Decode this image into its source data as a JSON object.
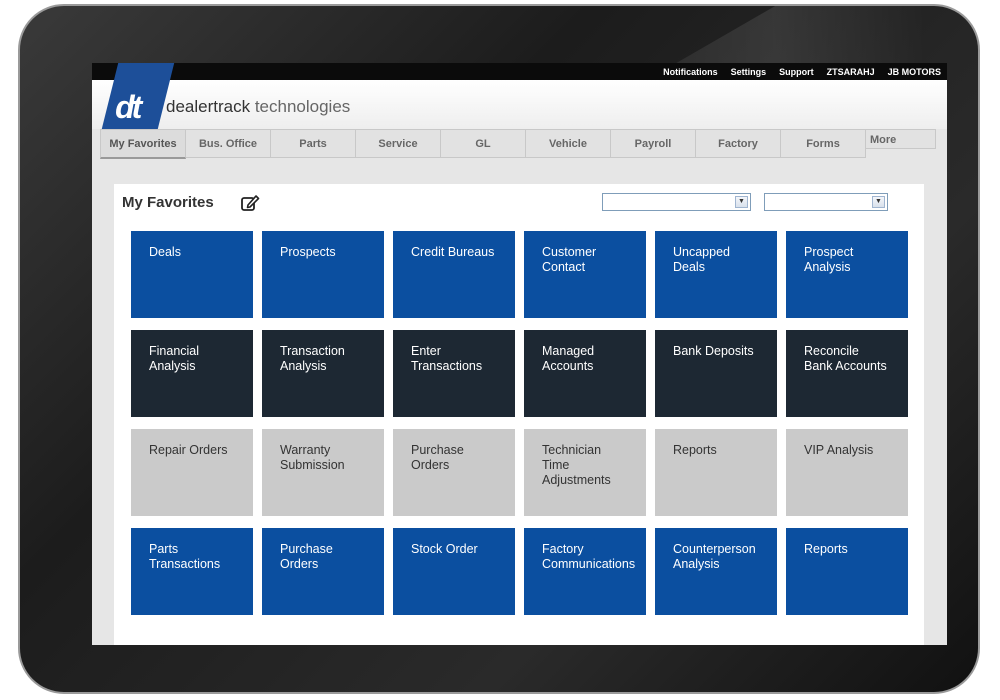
{
  "topbar": {
    "links": [
      "Notifications",
      "Settings",
      "Support",
      "ZTSARAHJ",
      "JB MOTORS"
    ]
  },
  "brand": {
    "mark": "dt",
    "name_bold": "dealertrack",
    "name_light": " technologies"
  },
  "tabs": [
    "My Favorites",
    "Bus. Office",
    "Parts",
    "Service",
    "GL",
    "Vehicle",
    "Payroll",
    "Factory",
    "Forms",
    "More"
  ],
  "favorites": {
    "title": "My Favorites",
    "select1_value": "",
    "select2_value": ""
  },
  "tiles": [
    {
      "label": "Deals",
      "style": "blue"
    },
    {
      "label": "Prospects",
      "style": "blue"
    },
    {
      "label": "Credit Bureaus",
      "style": "blue"
    },
    {
      "label": "Customer Contact",
      "style": "blue"
    },
    {
      "label": "Uncapped Deals",
      "style": "blue"
    },
    {
      "label": "Prospect Analysis",
      "style": "blue"
    },
    {
      "label": "Financial Analysis",
      "style": "dark"
    },
    {
      "label": "Transaction Analysis",
      "style": "dark"
    },
    {
      "label": "Enter Transactions",
      "style": "dark"
    },
    {
      "label": "Managed Accounts",
      "style": "dark"
    },
    {
      "label": "Bank Deposits",
      "style": "dark"
    },
    {
      "label": "Reconcile Bank Accounts",
      "style": "dark"
    },
    {
      "label": "Repair Orders",
      "style": "gray"
    },
    {
      "label": "Warranty Submission",
      "style": "gray"
    },
    {
      "label": "Purchase Orders",
      "style": "gray"
    },
    {
      "label": "Technician Time Adjustments",
      "style": "gray"
    },
    {
      "label": "Reports",
      "style": "gray"
    },
    {
      "label": "VIP Analysis",
      "style": "gray"
    },
    {
      "label": "Parts Transactions",
      "style": "blue"
    },
    {
      "label": "Purchase Orders",
      "style": "blue"
    },
    {
      "label": "Stock Order",
      "style": "blue"
    },
    {
      "label": "Factory Communications",
      "style": "blue"
    },
    {
      "label": "Counterperson Analysis",
      "style": "blue"
    },
    {
      "label": "Reports",
      "style": "blue"
    }
  ],
  "colors": {
    "tile_blue": "#0b4fa0",
    "tile_dark": "#1d2833",
    "tile_gray": "#cacaca",
    "brand": "#1d4f99"
  }
}
